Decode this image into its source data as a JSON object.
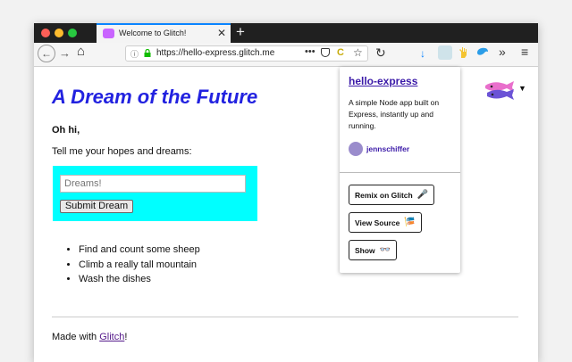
{
  "browser": {
    "tab": {
      "title": "Welcome to Glitch!",
      "close": "✕"
    },
    "new_tab": "+",
    "url": "https://hello-express.glitch.me",
    "url_more": "•••",
    "nav": {
      "back": "←",
      "forward": "→",
      "home": "⌂",
      "reload": "↻"
    },
    "toolbar": {
      "download": "↓",
      "overflow": "»",
      "menu": "≡"
    },
    "colors": {
      "titlebar": "#202020",
      "tab_accent": "#0a84ff"
    }
  },
  "page": {
    "heading": "A Dream of the Future",
    "greeting": "Oh hi,",
    "prompt": "Tell me your hopes and dreams:",
    "input_placeholder": "Dreams!",
    "submit_label": "Submit Dream",
    "dreams": [
      "Find and count some sheep",
      "Climb a really tall mountain",
      "Wash the dishes"
    ],
    "footer_prefix": "Made with ",
    "footer_link": "Glitch",
    "footer_suffix": "!",
    "colors": {
      "heading": "#2222e0",
      "form_bg": "#00ffff"
    }
  },
  "popup": {
    "project_name": "hello-express",
    "description": "A simple Node app built on Express, instantly up and running.",
    "author": "jennschiffer",
    "buttons": {
      "remix": "Remix on Glitch",
      "view_source": "View Source",
      "show": "Show"
    },
    "icons": {
      "remix": "🎤",
      "view_source": "🎏",
      "show": "👓"
    }
  }
}
